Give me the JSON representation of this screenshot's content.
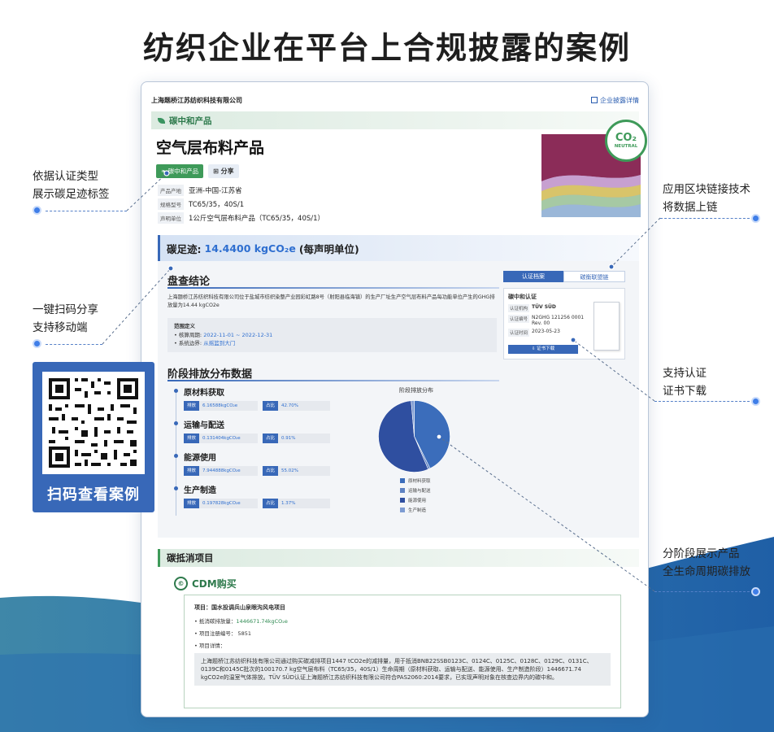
{
  "page": {
    "title": "纺织企业在平台上合规披露的案例"
  },
  "annotations": {
    "a1_line1": "依据认证类型",
    "a1_line2": "展示碳足迹标签",
    "a2_line1": "一键扫码分享",
    "a2_line2": "支持移动端",
    "a3_line1": "应用区块链接技术",
    "a3_line2": "将数据上链",
    "a4_line1": "支持认证",
    "a4_line2": "证书下载",
    "a5_line1": "分阶段展示产品",
    "a5_line2": "全生命周期碳排放"
  },
  "qr": {
    "label": "扫码查看案例"
  },
  "device": {
    "company": "上海题桥江苏纺织科技有限公司",
    "disclosure_link": "企业披露详情",
    "section_label": "碳中和产品",
    "product_title": "空气层布料产品",
    "tag_neutral": "碳中和产品",
    "tag_share": "分享",
    "info": [
      {
        "key": "产品产地",
        "value": "亚洲-中国-江苏省"
      },
      {
        "key": "规格型号",
        "value": "TC65/35，40S/1"
      },
      {
        "key": "声明单位",
        "value": "1公斤空气层布料产品（TC65/35，40S/1）"
      }
    ],
    "badge": {
      "co2": "CO₂",
      "neutral": "NEUTRAL"
    },
    "footprint": {
      "label": "碳足迹:",
      "value": "14.4400 kgCO₂e",
      "unit": "(每声明单位)"
    },
    "conclusion": {
      "heading": "盘查结论",
      "text": "上海题桥江苏纺织科技有限公司位于盐城市纺织染整产业园彩虹路8号（射阳县临海镇）的生产厂址生产空气层布料产品每功能单位产生的GHG排放量为14.44 kgCO2e",
      "scope_title": "范围定义",
      "period_label": "核算周期:",
      "period_value": "2022-11-01 ~ 2022-12-31",
      "boundary_label": "系统边界:",
      "boundary_value": "从摇篮到大门"
    },
    "tabs": {
      "active": "认证档案",
      "inactive": "碳衡联盟链"
    },
    "cert": {
      "title": "碳中和认证",
      "org_key": "认证机构",
      "org_value": "TÜV SÜD",
      "no_key": "认证编号",
      "no_value": "N2GHG 121256 0001 Rev. 00",
      "time_key": "认证时间",
      "time_value": "2023-05-23",
      "download": "证书下载"
    },
    "stage": {
      "heading": "阶段排放分布数据",
      "emit_key": "排放",
      "share_key": "占比",
      "items": [
        {
          "name": "原材料获取",
          "emission": "6.16588kgCO₂e",
          "share": "42.70%"
        },
        {
          "name": "运输与配送",
          "emission": "0.131404kgCO₂e",
          "share": "0.91%"
        },
        {
          "name": "能源使用",
          "emission": "7.944888kgCO₂e",
          "share": "55.02%"
        },
        {
          "name": "生产制造",
          "emission": "0.197828kgCO₂e",
          "share": "1.37%"
        }
      ]
    },
    "pie": {
      "title": "阶段排放分布",
      "legend": [
        "原材料获取",
        "运输与配送",
        "能源使用",
        "生产制造"
      ]
    },
    "offset": {
      "section": "碳抵消项目",
      "cdm": "CDM购买",
      "project": "项目：国水投调兵山泉眼沟风电项目",
      "amount_label": "• 抵消碳排放量：",
      "amount_value": "1446671.74kgCO₂e",
      "reg_no": "• 项目注册编号：  5851",
      "detail_label": "• 项目详情：",
      "detail": "上海题桥江苏纺织科技有限公司通过购买碳减排项目1447 tCO2e的减排量，用于抵消BNB22SSB0123C、0124C、0125C、0128C、0129C、0131C、0139C和0145C批次的100170.7 kg空气层布料（TC65/35，40S/1）生命周期（原材料获取、运输与配送、能源使用、生产制造阶段）1446671.74 kgCO2e的温室气体排放。TÜV SÜD认证上海题桥江苏纺织科技有限公司符合PAS2060:2014要求，已实现声明对象在核查边界内的碳中和。"
    }
  },
  "chart_data": {
    "type": "pie",
    "title": "阶段排放分布",
    "categories": [
      "原材料获取",
      "运输与配送",
      "能源使用",
      "生产制造"
    ],
    "values": [
      42.7,
      0.91,
      55.02,
      1.37
    ],
    "colors": [
      "#3b6dbb",
      "#5e82c2",
      "#2f4fa0",
      "#7d9bd2"
    ]
  }
}
